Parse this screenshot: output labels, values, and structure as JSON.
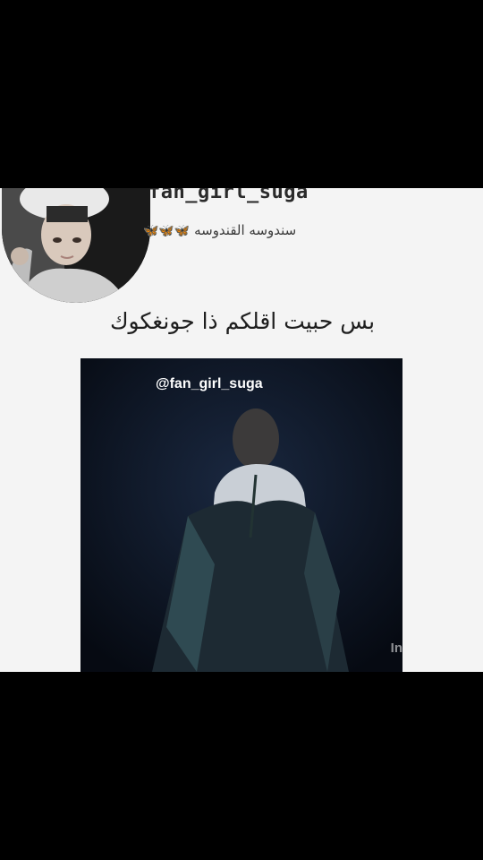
{
  "post": {
    "username": "fan_girl_suga",
    "bio_text": "سندوسه القندوسه",
    "bio_emoji": "🦋🦋🦋",
    "caption": "بس حبيت اقلكم ذا جونغكوك"
  },
  "media": {
    "watermark": "@fan_girl_suga",
    "corner_mark": "In"
  },
  "colors": {
    "background": "#000000",
    "card": "#f4f4f4",
    "media_bg": "#0c1320"
  }
}
